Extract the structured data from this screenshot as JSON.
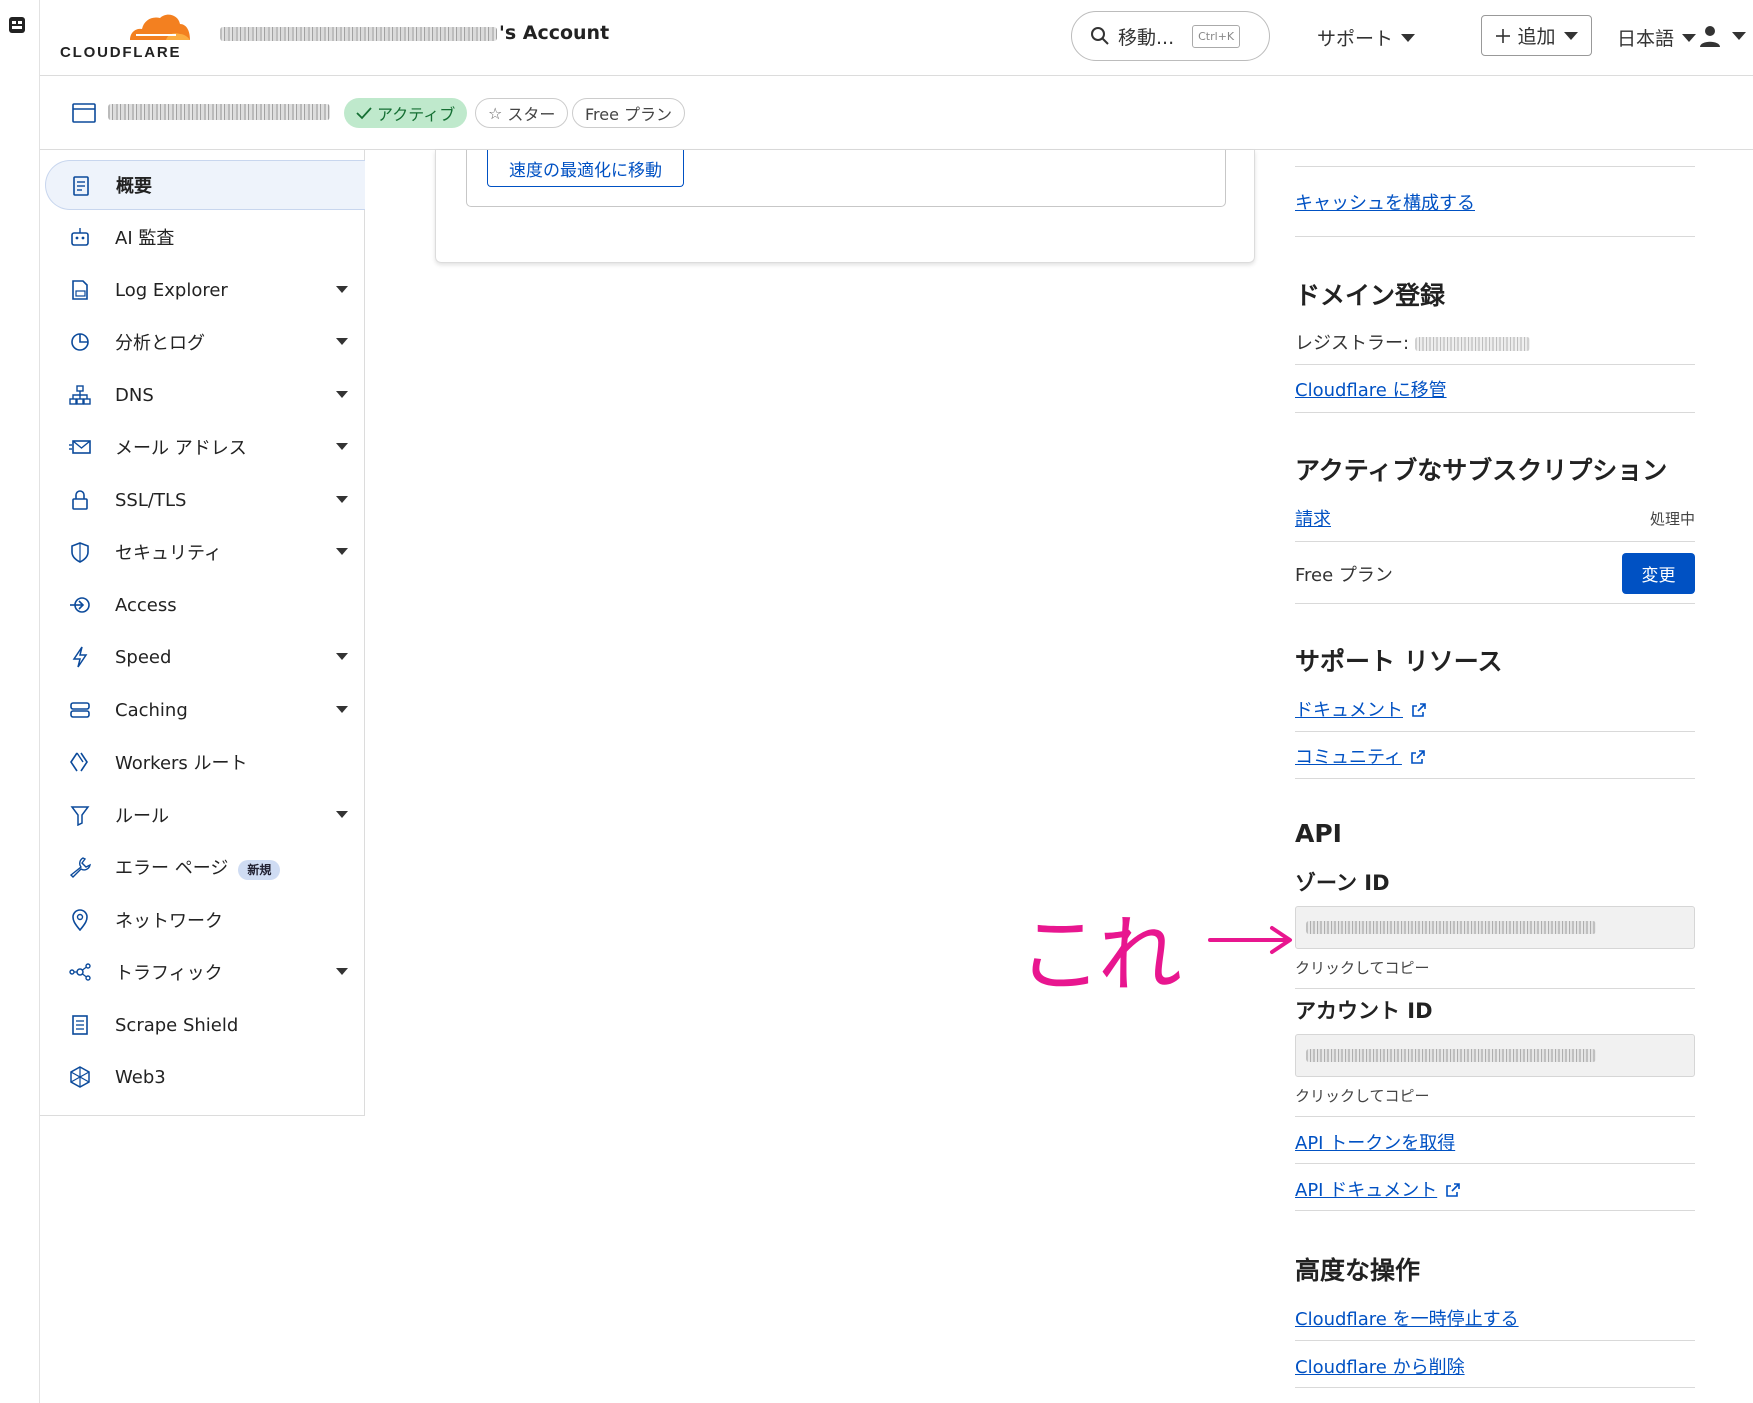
{
  "header": {
    "logo_text": "CLOUDFLARE",
    "account_suffix": "'s Account",
    "search_label": "移動...",
    "search_shortcut": "Ctrl+K",
    "support_label": "サポート",
    "add_label": "追加",
    "language_label": "日本語"
  },
  "zonebar": {
    "status_badge": "アクティブ",
    "star_label": "スター",
    "plan_badge": "Free プラン"
  },
  "sidebar": {
    "items": [
      {
        "label": "概要",
        "active": true,
        "dropdown": false
      },
      {
        "label": "AI 監査",
        "dropdown": false
      },
      {
        "label": "Log Explorer",
        "dropdown": true
      },
      {
        "label": "分析とログ",
        "dropdown": true
      },
      {
        "label": "DNS",
        "dropdown": true
      },
      {
        "label": "メール アドレス",
        "dropdown": true
      },
      {
        "label": "SSL/TLS",
        "dropdown": true
      },
      {
        "label": "セキュリティ",
        "dropdown": true
      },
      {
        "label": "Access",
        "dropdown": false
      },
      {
        "label": "Speed",
        "dropdown": true
      },
      {
        "label": "Caching",
        "dropdown": true
      },
      {
        "label": "Workers ルート",
        "dropdown": false
      },
      {
        "label": "ルール",
        "dropdown": true
      },
      {
        "label": "エラー ページ",
        "dropdown": false,
        "badge": "新規"
      },
      {
        "label": "ネットワーク",
        "dropdown": false
      },
      {
        "label": "トラフィック",
        "dropdown": true
      },
      {
        "label": "Scrape Shield",
        "dropdown": false
      },
      {
        "label": "Web3",
        "dropdown": false
      }
    ]
  },
  "main": {
    "speed_button": "速度の最適化に移動"
  },
  "right_panel": {
    "cache_link": "キャッシュを構成する",
    "domain_heading": "ドメイン登録",
    "registrar_label": "レジストラー: ",
    "transfer_link": "Cloudflare に移管",
    "subscriptions_heading": "アクティブなサブスクリプション",
    "billing_link": "請求",
    "billing_status": "処理中",
    "plan_text": "Free プラン",
    "change_button": "変更",
    "support_heading": "サポート リソース",
    "docs_link": "ドキュメント",
    "community_link": "コミュニティ",
    "api_heading": "API",
    "zone_id_label": "ゾーン ID",
    "zone_id_hint": "クリックしてコピー",
    "account_id_label": "アカウント ID",
    "account_id_hint": "クリックしてコピー",
    "api_token_link": "API トークンを取得",
    "api_docs_link": "API ドキュメント",
    "advanced_heading": "高度な操作",
    "pause_link": "Cloudflare を一時停止する",
    "remove_link": "Cloudflare から削除"
  },
  "annotation": {
    "text": "これ",
    "color": "#e8168f"
  },
  "colors": {
    "accent": "#0051c3",
    "logo_orange": "#f38020",
    "active_badge_bg": "#bfe9cc"
  }
}
